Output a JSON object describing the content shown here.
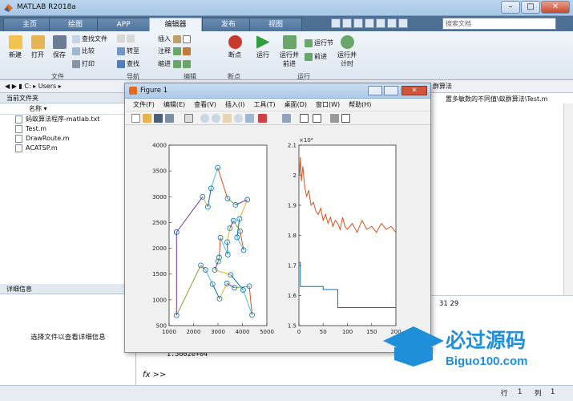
{
  "window": {
    "title": "MATLAB R2018a"
  },
  "tabs": [
    {
      "label": "主页",
      "left": 4
    },
    {
      "label": "绘图",
      "left": 72
    },
    {
      "label": "APP",
      "left": 120
    },
    {
      "label": "编辑器",
      "left": 186
    },
    {
      "label": "发布",
      "left": 252
    },
    {
      "label": "视图",
      "left": 311
    }
  ],
  "search": {
    "placeholder": "搜索文档"
  },
  "ribbon": {
    "file": {
      "new": "新建",
      "open": "打开",
      "save": "保存",
      "find_files": "查找文件",
      "compare": "比较",
      "print": "打印",
      "group": "文件"
    },
    "nav": {
      "goto": "转至",
      "find": "查找",
      "group": "导航"
    },
    "edit": {
      "insert": "插入",
      "comment": "注释",
      "indent": "缩进",
      "group": "编辑"
    },
    "breakpoints": {
      "label": "断点",
      "group": "断点"
    },
    "run": {
      "run": "运行",
      "run_advance": "运行并前进",
      "run_section": "运行节",
      "advance": "前进",
      "run_time": "运行并计时",
      "group": "运行"
    }
  },
  "address": {
    "drive": "C:",
    "users": "Users",
    "right_text": "群算法",
    "path": "置多敏数的不同值\\蚁群算法\\Test.m"
  },
  "current_folder": {
    "title": "当前文件夹",
    "col_name": "名称",
    "files": [
      "蚂蚁算法程序-matlab.txt",
      "Test.m",
      "DrawRoute.m",
      "ACATSP.m"
    ]
  },
  "details": {
    "title": "详细信息",
    "message": "选择文件以查看详细信息"
  },
  "command": {
    "numbers": "31    29",
    "value": "1.5602e+04",
    "prompt": "fx >>"
  },
  "status": {
    "row_label": "行",
    "row": "1",
    "col_label": "列",
    "col": "1"
  },
  "figure": {
    "title": "Figure 1",
    "menus": [
      "文件(F)",
      "编辑(E)",
      "查看(V)",
      "插入(I)",
      "工具(T)",
      "桌面(D)",
      "窗口(W)",
      "帮助(H)"
    ]
  },
  "watermark": {
    "name": "必过源码",
    "url": "Biguo100.com"
  },
  "chart_data": [
    {
      "type": "line",
      "title": "",
      "xlim": [
        1000,
        5000
      ],
      "ylim": [
        500,
        4000
      ],
      "xticks": [
        1000,
        2000,
        3000,
        4000,
        5000
      ],
      "yticks": [
        500,
        1000,
        1500,
        2000,
        2500,
        3000,
        3500,
        4000
      ],
      "route": [
        [
          1304,
          2312
        ],
        [
          2374,
          2999
        ],
        [
          2586,
          2804
        ],
        [
          2717,
          3161
        ],
        [
          2988,
          3563
        ],
        [
          3394,
          2965
        ],
        [
          3717,
          2843
        ],
        [
          4201,
          2943
        ],
        [
          3882,
          2571
        ],
        [
          3780,
          2212
        ],
        [
          4050,
          1963
        ],
        [
          3904,
          2332
        ],
        [
          3636,
          2535
        ],
        [
          3488,
          2390
        ],
        [
          3376,
          2120
        ],
        [
          3400,
          1878
        ],
        [
          3100,
          2206
        ],
        [
          3046,
          1823
        ],
        [
          3007,
          1742
        ],
        [
          2867,
          1582
        ],
        [
          3522,
          1484
        ],
        [
          4029,
          1193
        ],
        [
          4396,
          706
        ],
        [
          4281,
          1264
        ],
        [
          3676,
          1234
        ],
        [
          3364,
          1318
        ],
        [
          3064,
          1023
        ],
        [
          2778,
          1303
        ],
        [
          2485,
          1582
        ],
        [
          2296,
          1669
        ],
        [
          1304,
          700
        ],
        [
          1304,
          2312
        ]
      ]
    },
    {
      "type": "line",
      "title": "",
      "xlim": [
        0,
        200
      ],
      "ylim": [
        1.5,
        2.1
      ],
      "yexp": "×10⁴",
      "xticks": [
        0,
        50,
        100,
        150,
        200
      ],
      "yticks": [
        1.5,
        1.6,
        1.7,
        1.8,
        1.9,
        2.0,
        2.1
      ],
      "series": [
        {
          "color": "#d95319",
          "x": [
            1,
            3,
            5,
            8,
            12,
            16,
            20,
            25,
            30,
            35,
            40,
            45,
            50,
            55,
            60,
            65,
            70,
            75,
            80,
            85,
            90,
            95,
            100,
            110,
            120,
            130,
            140,
            150,
            160,
            170,
            180,
            190,
            200
          ],
          "y": [
            2.0,
            2.06,
            1.98,
            2.03,
            1.96,
            1.93,
            1.95,
            1.9,
            1.91,
            1.88,
            1.87,
            1.89,
            1.85,
            1.87,
            1.84,
            1.86,
            1.83,
            1.85,
            1.84,
            1.82,
            1.86,
            1.83,
            1.82,
            1.84,
            1.81,
            1.85,
            1.82,
            1.83,
            1.81,
            1.84,
            1.82,
            1.83,
            1.81
          ]
        },
        {
          "color": "#0072bd",
          "x": [
            0,
            3,
            3,
            50,
            50,
            80,
            80,
            200
          ],
          "y": [
            1.71,
            1.71,
            1.63,
            1.63,
            1.62,
            1.62,
            1.56,
            1.56
          ]
        }
      ]
    }
  ]
}
